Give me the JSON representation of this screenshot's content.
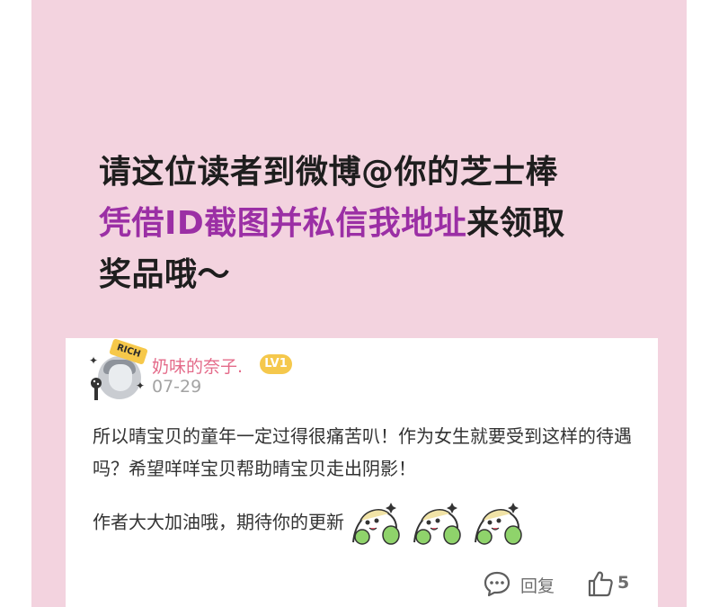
{
  "notice": {
    "line1": "请这位读者到微博@你的芝士棒",
    "line2_highlight": "凭借ID截图并私信我地址",
    "line2_rest": "来领取",
    "line3": "奖品哦～"
  },
  "comment": {
    "badge_text": "RICH",
    "username": "奶味的奈子.",
    "level_badge": "LV1",
    "date": "07-29",
    "paragraph1": "所以晴宝贝的童年一定过得很痛苦叭！作为女生就要受到这样的待遇吗？希望咩咩宝贝帮助晴宝贝走出阴影！",
    "paragraph2": "作者大大加油哦，期待你的更新",
    "emoji_icon": "cheering-sticker-icon",
    "reply_label": "回复",
    "like_count": "5"
  },
  "colors": {
    "panel_bg": "#f3d3df",
    "highlight": "#9b2fa5",
    "username": "#e46b8a",
    "level_badge": "#f5c84c"
  }
}
